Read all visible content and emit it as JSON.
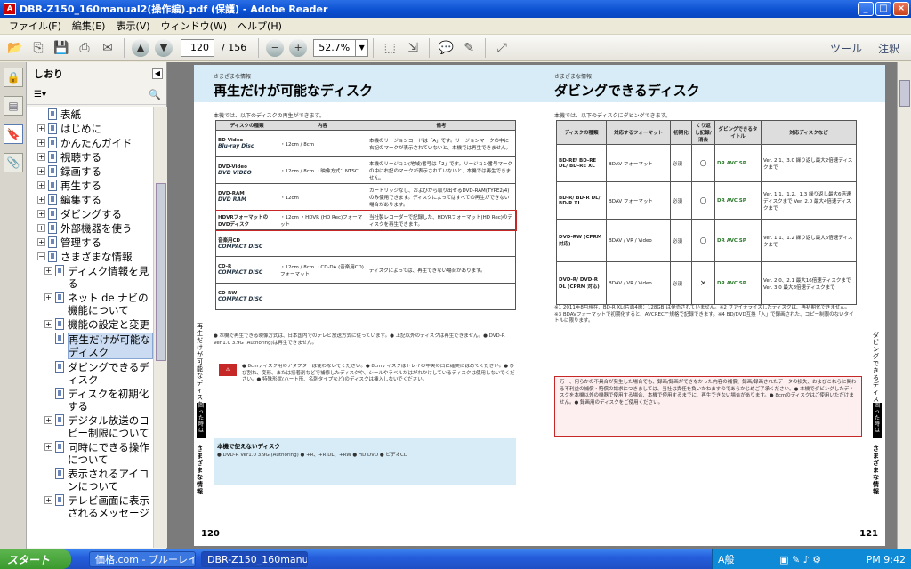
{
  "window": {
    "title": "DBR-Z150_160manual2(操作編).pdf (保護) - Adobe Reader"
  },
  "menu": [
    "ファイル(F)",
    "編集(E)",
    "表示(V)",
    "ウィンドウ(W)",
    "ヘルプ(H)"
  ],
  "toolbar": {
    "page_current": "120",
    "page_total": "/ 156",
    "zoom": "52.7%",
    "tools": "ツール",
    "comment": "注釈"
  },
  "bookmarks": {
    "title": "しおり",
    "items": [
      {
        "label": "表紙",
        "exp": "",
        "level": 0
      },
      {
        "label": "はじめに",
        "exp": "+",
        "level": 0
      },
      {
        "label": "かんたんガイド",
        "exp": "+",
        "level": 0
      },
      {
        "label": "視聴する",
        "exp": "+",
        "level": 0
      },
      {
        "label": "録画する",
        "exp": "+",
        "level": 0
      },
      {
        "label": "再生する",
        "exp": "+",
        "level": 0
      },
      {
        "label": "編集する",
        "exp": "+",
        "level": 0
      },
      {
        "label": "ダビングする",
        "exp": "+",
        "level": 0
      },
      {
        "label": "外部機器を使う",
        "exp": "+",
        "level": 0
      },
      {
        "label": "管理する",
        "exp": "+",
        "level": 0
      },
      {
        "label": "さまざまな情報",
        "exp": "−",
        "level": 0
      },
      {
        "label": "ディスク情報を見る",
        "exp": "+",
        "level": 1
      },
      {
        "label": "ネット de ナビの機能について",
        "exp": "+",
        "level": 1
      },
      {
        "label": "機能の設定と変更",
        "exp": "+",
        "level": 1
      },
      {
        "label": "再生だけが可能なディスク",
        "exp": "",
        "level": 1,
        "sel": true
      },
      {
        "label": "ダビングできるディスク",
        "exp": "",
        "level": 1
      },
      {
        "label": "ディスクを初期化する",
        "exp": "",
        "level": 1
      },
      {
        "label": "デジタル放送のコピー制限について",
        "exp": "+",
        "level": 1
      },
      {
        "label": "同時にできる操作について",
        "exp": "+",
        "level": 1
      },
      {
        "label": "表示されるアイコンについて",
        "exp": "",
        "level": 1
      },
      {
        "label": "テレビ画面に表示されるメッセージ",
        "exp": "+",
        "level": 1
      }
    ]
  },
  "left_page": {
    "sub": "さまざまな情報",
    "title": "再生だけが可能なディスク",
    "intro": "本機では、以下のディスクの再生ができます。",
    "headers": [
      "ディスクの種類",
      "内容",
      "備考"
    ],
    "rows": [
      {
        "disc": "BD-Video",
        "logo": "Blu-ray Disc",
        "content": "・12cm / 8cm",
        "note": "本機のリージョンコードは「A」です。リージョンマークの中に右記のマークが表示されていないと、本機では再生できません。"
      },
      {
        "disc": "DVD-Video",
        "logo": "DVD VIDEO",
        "content": "・12cm / 8cm ・映像方式：NTSC",
        "note": "本機のリージョン(地域)番号は「2」です。リージョン番号マークの中に右記のマークが表示されていないと、本機では再生できません。"
      },
      {
        "disc": "DVD-RAM",
        "logo": "DVD RAM",
        "content": "・12cm",
        "note": "カートリッジなし、およびから取り出せるDVD-RAM(TYPE2/4)のみ使用できます。ディスクによってはすべての再生ができない場合があります。"
      },
      {
        "disc": "HDVRフォーマットのDVDディスク",
        "logo": "",
        "content": "・12cm ・HDVR (HD Rec)フォーマット",
        "note": "当社製レコーダーで記録した、HDVRフォーマット(HD Rec)のディスクを再生できます。"
      },
      {
        "disc": "音楽用CD",
        "logo": "COMPACT DISC",
        "content": "",
        "note": ""
      },
      {
        "disc": "CD-R",
        "logo": "COMPACT DISC",
        "content": "・12cm / 8cm ・CD-DA (音楽用CD)フォーマット",
        "note": "ディスクによっては、再生できない場合があります。"
      },
      {
        "disc": "CD-RW",
        "logo": "COMPACT DISC",
        "content": "",
        "note": ""
      }
    ],
    "notes": "● 本機で再生できる映像方式は、日本国内でのテレビ放送方式に従っています。● 上記以外のディスクは再生できません。● DVD-R Ver.1.0 3.9G (Authoring)は再生できません。",
    "caution": "● 8cmディスク用のアダプターは使わないでください。● 8cmディスクはトレイの中央の凹に確実にはめてください。● ひび割れ、変形、または接着剤などで補修したディスクや、シールやラベルがはがれかけしているディスクは使用しないでください。● 特殊形状(ハート形、名刺タイプなど)のディスクは挿入しないでください。",
    "cannot_title": "本機で使えないディスク",
    "cannot": "● DVD-R Ver1.0 3.9G (Authoring) ● +R、+R DL、+RW ● HD DVD ● ビデオCD",
    "side_tab": "再生だけが可能なディスク",
    "side_black": "困った時は",
    "side_bottom": "さまざまな情報",
    "page_no": "120"
  },
  "right_page": {
    "sub": "さまざまな情報",
    "title": "ダビングできるディスク",
    "intro": "本機では、以下のディスクにダビングできます。",
    "headers": [
      "ディスクの種類",
      "対応するフォーマット",
      "初期化",
      "くり返し記録/消去",
      "ダビングできるタイトル",
      "対応ディスクなど"
    ],
    "rows": [
      {
        "disc": "BD-RE/ BD-RE DL/ BD-RE XL",
        "fmt": "BDAV フォーマット",
        "init": "必須",
        "rep": "○",
        "title": "DR AVC SP",
        "ver": "Ver. 2.1、3.0 繰り返し最大2倍速ディスクまで"
      },
      {
        "disc": "BD-R/ BD-R DL/ BD-R XL",
        "fmt": "BDAV フォーマット",
        "init": "必須",
        "rep": "○",
        "title": "DR AVC SP",
        "ver": "Ver. 1.1、1.2、1.3 繰り返し最大6倍速ディスクまで Ver. 2.0 最大4倍速ディスクまで"
      },
      {
        "disc": "DVD-RW (CPRM 対応)",
        "fmt": "BDAV / VR / Video",
        "init": "必須",
        "rep": "○",
        "title": "DR AVC SP",
        "ver": "Ver. 1.1、1.2 繰り返し最大6倍速ディスクまで"
      },
      {
        "disc": "DVD-R/ DVD-R DL (CPRM 対応)",
        "fmt": "BDAV / VR / Video",
        "init": "必須",
        "rep": "×",
        "title": "DR AVC SP",
        "ver": "Ver. 2.0、2.1 最大16倍速ディスクまで Ver. 3.0 最大8倍速ディスクまで"
      }
    ],
    "notes": "※1 2011年8月現在、BD-R XL(片面4層：128GB)は発売されていません。※2 ファイナライズしたディスクは、再初期化できません。※3 BDAVフォーマットで初期化すると、AVCREC™規格で記録できます。※4 BD/DVD互換「入」で録画された、コピー制限のないタイトルに限ります。",
    "warn": "万一、何らかの不具合が発生した場合でも、録画/録画ができなかった内容の補償、録画/録画されたデータの損失、およびこれらに関わる不利益の補償・賠償の請求につきましては、当社は責任を負いかねますのであらかじめご了承ください。● 本機でダビングしたディスクを本機以外の機器で使用する場合、本機で使用するまでに、再生できない場合があります。● 8cmのディスクはご使用いただけません。● 録画用のディスクをご使用ください。",
    "side_tab": "ダビングできるディスク",
    "side_black": "困った時は",
    "side_bottom": "さまざまな情報",
    "page_no": "121"
  },
  "taskbar": {
    "start": "スタート",
    "tasks": [
      "価格.com - ブルーレイ...",
      "DBR-Z150_160manua..."
    ],
    "ime": "A般",
    "time": "PM 9:42"
  },
  "colors": {
    "title_blue": "#0a4fd0",
    "header_band": "#d7ecf6",
    "highlight": "#c62828",
    "doc_bg": "#7b7b7b"
  }
}
